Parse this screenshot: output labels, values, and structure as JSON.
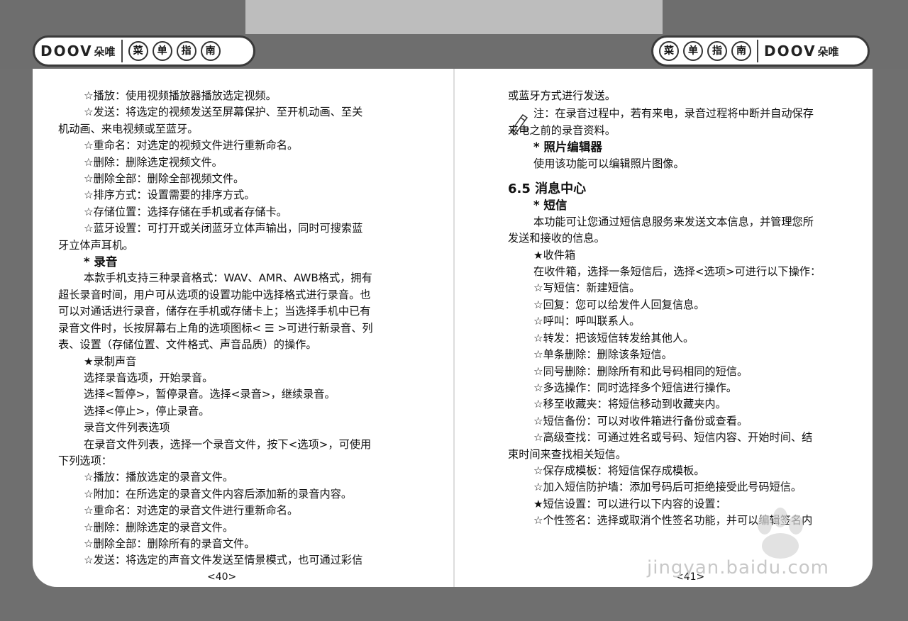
{
  "header": {
    "logo_text": "DOOV",
    "logo_cn": "朵唯",
    "menu_chars": [
      "菜",
      "单",
      "指",
      "南"
    ]
  },
  "left": {
    "lines": [
      {
        "t": "☆播放：使用视频播放器播放选定视频。",
        "i": 1
      },
      {
        "t": "☆发送：将选定的视频发送至屏幕保护、至开机动画、至关",
        "i": 1
      },
      {
        "t": "机动画、来电视频或至蓝牙。",
        "i": 0
      },
      {
        "t": "☆重命名：对选定的视频文件进行重新命名。",
        "i": 1
      },
      {
        "t": "☆删除：删除选定视频文件。",
        "i": 1
      },
      {
        "t": "☆删除全部：删除全部视频文件。",
        "i": 1
      },
      {
        "t": "☆排序方式：设置需要的排序方式。",
        "i": 1
      },
      {
        "t": "☆存储位置：选择存储在手机或者存储卡。",
        "i": 1
      },
      {
        "t": "☆蓝牙设置：可打开或关闭蓝牙立体声输出，同时可搜索蓝",
        "i": 1
      },
      {
        "t": "牙立体声耳机。",
        "i": 0
      },
      {
        "t": "* 录音",
        "i": 1,
        "h": 1
      },
      {
        "t": "本款手机支持三种录音格式：WAV、AMR、AWB格式，拥有",
        "i": 1
      },
      {
        "t": "超长录音时间，用户可从选项的设置功能中选择格式进行录音。也",
        "i": 0
      },
      {
        "t": "可以对通话进行录音，储存在手机或存储卡上；当选择手机中已有",
        "i": 0
      },
      {
        "t": "录音文件时，长按屏幕右上角的选项图标< ☰ >可进行新录音、列",
        "i": 0
      },
      {
        "t": "表、设置（存储位置、文件格式、声音品质）的操作。",
        "i": 0
      },
      {
        "t": "★录制声音",
        "i": 1
      },
      {
        "t": "选择录音选项，开始录音。",
        "i": 1
      },
      {
        "t": "选择<暂停>，暂停录音。选择<录音>，继续录音。",
        "i": 1
      },
      {
        "t": "选择<停止>，停止录音。",
        "i": 1
      },
      {
        "t": "录音文件列表选项",
        "i": 1
      },
      {
        "t": "在录音文件列表，选择一个录音文件，按下<选项>，可使用",
        "i": 1
      },
      {
        "t": "下列选项：",
        "i": 0
      },
      {
        "t": "☆播放：播放选定的录音文件。",
        "i": 1
      },
      {
        "t": "☆附加：在所选定的录音文件内容后添加新的录音内容。",
        "i": 1
      },
      {
        "t": "☆重命名：对选定的录音文件进行重新命名。",
        "i": 1
      },
      {
        "t": "☆删除：删除选定的录音文件。",
        "i": 1
      },
      {
        "t": "☆删除全部：删除所有的录音文件。",
        "i": 1
      },
      {
        "t": "☆发送：将选定的声音文件发送至情景模式，也可通过彩信",
        "i": 1
      }
    ],
    "page_number": "<40>"
  },
  "right": {
    "lines": [
      {
        "t": "或蓝牙方式进行发送。",
        "i": 0
      },
      {
        "t": "",
        "i": 0
      },
      {
        "t": "注：在录音过程中，若有来电，录音过程将中断并自动保存",
        "i": 0,
        "note": 1
      },
      {
        "t": "来电之前的录音资料。",
        "i": 0
      },
      {
        "t": "* 照片编辑器",
        "i": 1,
        "h": 1
      },
      {
        "t": "使用该功能可以编辑照片图像。",
        "i": 1
      },
      {
        "t": "",
        "i": 0
      },
      {
        "t": "6.5 消息中心",
        "i": 0,
        "h2": 1
      },
      {
        "t": "* 短信",
        "i": 1,
        "h": 1
      },
      {
        "t": "本功能可让您通过短信息服务来发送文本信息，并管理您所",
        "i": 1
      },
      {
        "t": "发送和接收的信息。",
        "i": 0
      },
      {
        "t": "★收件箱",
        "i": 1
      },
      {
        "t": "在收件箱，选择一条短信后，选择<选项>可进行以下操作：",
        "i": 1
      },
      {
        "t": "☆写短信：新建短信。",
        "i": 1
      },
      {
        "t": "☆回复：您可以给发件人回复信息。",
        "i": 1
      },
      {
        "t": "☆呼叫：呼叫联系人。",
        "i": 1
      },
      {
        "t": "☆转发：把该短信转发给其他人。",
        "i": 1
      },
      {
        "t": "☆单条删除：删除该条短信。",
        "i": 1
      },
      {
        "t": "☆同号删除：删除所有和此号码相同的短信。",
        "i": 1
      },
      {
        "t": "☆多选操作：同时选择多个短信进行操作。",
        "i": 1
      },
      {
        "t": "☆移至收藏夹：将短信移动到收藏夹内。",
        "i": 1
      },
      {
        "t": "☆短信备份：可以对收件箱进行备份或查看。",
        "i": 1
      },
      {
        "t": "☆高级查找：可通过姓名或号码、短信内容、开始时间、结",
        "i": 1
      },
      {
        "t": "束时间来查找相关短信。",
        "i": 0
      },
      {
        "t": "☆保存成模板：将短信保存成模板。",
        "i": 1
      },
      {
        "t": "☆加入短信防护墙：添加号码后可拒绝接受此号码短信。",
        "i": 1
      },
      {
        "t": "★短信设置：可以进行以下内容的设置：",
        "i": 1
      },
      {
        "t": "☆个性签名：选择或取消个性签名功能，并可以编辑签名内",
        "i": 1
      }
    ],
    "page_number": "<41>"
  },
  "watermark": "jingyan.baidu.com"
}
